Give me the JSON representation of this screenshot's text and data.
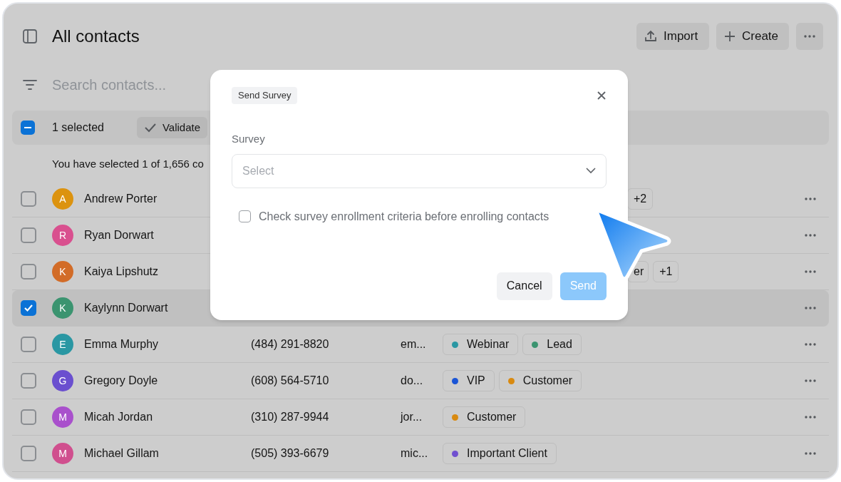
{
  "header": {
    "title": "All contacts",
    "buttons": [
      {
        "kind": "import",
        "label": "Import"
      },
      {
        "kind": "create",
        "label": "Create"
      },
      {
        "kind": "more"
      }
    ]
  },
  "search": {
    "placeholder": "Search contacts..."
  },
  "selection_bar": {
    "indeterminate": true,
    "label": "1 selected",
    "action": "Validate"
  },
  "selection_note": "You have selected 1 of 1,656 co",
  "rows": [
    {
      "initial": "A",
      "color": "#dc930f",
      "name": "Andrew Porter",
      "checked": false,
      "tags": [],
      "more_tags": "+2"
    },
    {
      "initial": "R",
      "color": "#d9508f",
      "name": "Ryan Dorwart",
      "checked": false,
      "tags": []
    },
    {
      "initial": "K",
      "color": "#d26c28",
      "name": "Kaiya Lipshutz",
      "checked": false,
      "tags": [
        {
          "label": "er"
        }
      ],
      "more_tags": "+1"
    },
    {
      "initial": "K",
      "color": "#3b9470",
      "name": "Kaylynn Dorwart",
      "checked": true,
      "tags": []
    },
    {
      "initial": "E",
      "color": "#2a97a3",
      "name": "Emma Murphy",
      "phone": "(484) 291-8820",
      "email": "em...",
      "checked": false,
      "tags": [
        {
          "label": "Webinar",
          "color": "#2a97a3"
        },
        {
          "label": "Lead",
          "color": "#3b9470"
        }
      ]
    },
    {
      "initial": "G",
      "color": "#6a4fcf",
      "name": "Gregory Doyle",
      "phone": "(608) 564-5710",
      "email": "do...",
      "checked": false,
      "tags": [
        {
          "label": "VIP",
          "color": "#1a55d6"
        },
        {
          "label": "Customer",
          "color": "#d98a10"
        }
      ]
    },
    {
      "initial": "M",
      "color": "#a950cc",
      "name": "Micah Jordan",
      "phone": "(310) 287-9944",
      "email": "jor...",
      "checked": false,
      "tags": [
        {
          "label": "Customer",
          "color": "#d98a10"
        }
      ]
    },
    {
      "initial": "M",
      "color": "#d04f8e",
      "name": "Michael Gillam",
      "phone": "(505) 393-6679",
      "email": "mic...",
      "checked": false,
      "tags": [
        {
          "label": "Important Client",
          "color": "#7050d0"
        }
      ]
    }
  ],
  "dialog": {
    "badge": "Send Survey",
    "field_label": "Survey",
    "select_placeholder": "Select",
    "option": {
      "label": "Check survey enrollment criteria before enrolling contacts",
      "checked": false
    },
    "buttons": [
      {
        "kind": "secondary",
        "label": "Cancel"
      },
      {
        "kind": "primary",
        "label": "Send",
        "disabled": true
      }
    ]
  }
}
